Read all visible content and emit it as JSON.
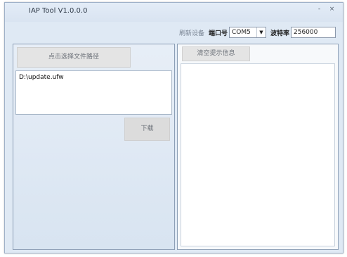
{
  "window": {
    "title": "IAP Tool V1.0.0.0",
    "controls": {
      "minimize": "-",
      "close": "×"
    }
  },
  "topbar": {
    "refresh_label": "刷新设备",
    "port_label": "端口号",
    "port_value": "COM5",
    "port_arrow": "▼",
    "baud_label": "波特率",
    "baud_value": "256000"
  },
  "left_panel": {
    "select_file_label": "点击选择文件路径",
    "file_path": "D:\\update.ufw",
    "download_label": "下载"
  },
  "right_panel": {
    "clear_label": "清空提示信息",
    "log_text": ""
  }
}
